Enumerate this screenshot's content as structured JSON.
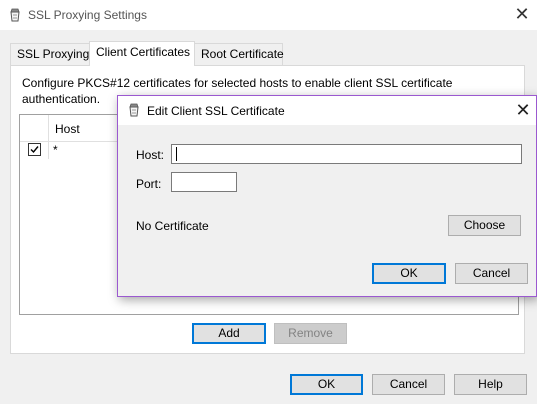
{
  "window": {
    "title": "SSL Proxying Settings",
    "close_glyph": "✕"
  },
  "tabs": [
    {
      "label": "SSL Proxying",
      "active": false
    },
    {
      "label": "Client Certificates",
      "active": true
    },
    {
      "label": "Root Certificate",
      "active": false
    }
  ],
  "panel": {
    "description": "Configure PKCS#12 certificates for selected hosts to enable client SSL certificate authentication.",
    "table": {
      "columns": [
        "Host"
      ],
      "rows": [
        {
          "checked": true,
          "host": "*"
        }
      ]
    },
    "add_label": "Add",
    "remove_label": "Remove"
  },
  "footer": {
    "ok_label": "OK",
    "cancel_label": "Cancel",
    "help_label": "Help"
  },
  "dialog": {
    "title": "Edit Client SSL Certificate",
    "close_glyph": "✕",
    "host_label": "Host:",
    "host_value": "",
    "port_label": "Port:",
    "port_value": "",
    "certificate_status": "No Certificate",
    "choose_label": "Choose",
    "ok_label": "OK",
    "cancel_label": "Cancel",
    "accent_color": "#9b59d0"
  },
  "icons": {
    "app_icon": "charles-proxy-pot-icon"
  }
}
